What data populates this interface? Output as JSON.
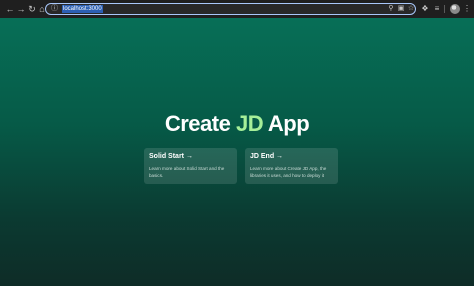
{
  "browser": {
    "url": "localhost:3000",
    "icons": {
      "back": "arrow-left-icon",
      "forward": "arrow-right-icon",
      "reload": "reload-icon",
      "home": "home-icon",
      "site_info": "info-icon",
      "zoom": "magnifier-icon",
      "lock": "lock-icon",
      "star": "star-icon",
      "extensions": "puzzle-icon",
      "media": "media-icon",
      "profile": "avatar-icon",
      "menu": "kebab-menu-icon"
    }
  },
  "page": {
    "title_prefix": "Create ",
    "title_accent": "JD",
    "title_suffix": " App",
    "colors": {
      "background_top": "#076f57",
      "background_bottom": "#0e2c27",
      "accent": "#a6ef99"
    },
    "cards": [
      {
        "title": "Solid Start →",
        "description": "Learn more about Solid Start and the basics."
      },
      {
        "title": "JD End →",
        "description": "Learn more about Create JD App, the libraries it uses, and how to deploy it"
      }
    ]
  }
}
